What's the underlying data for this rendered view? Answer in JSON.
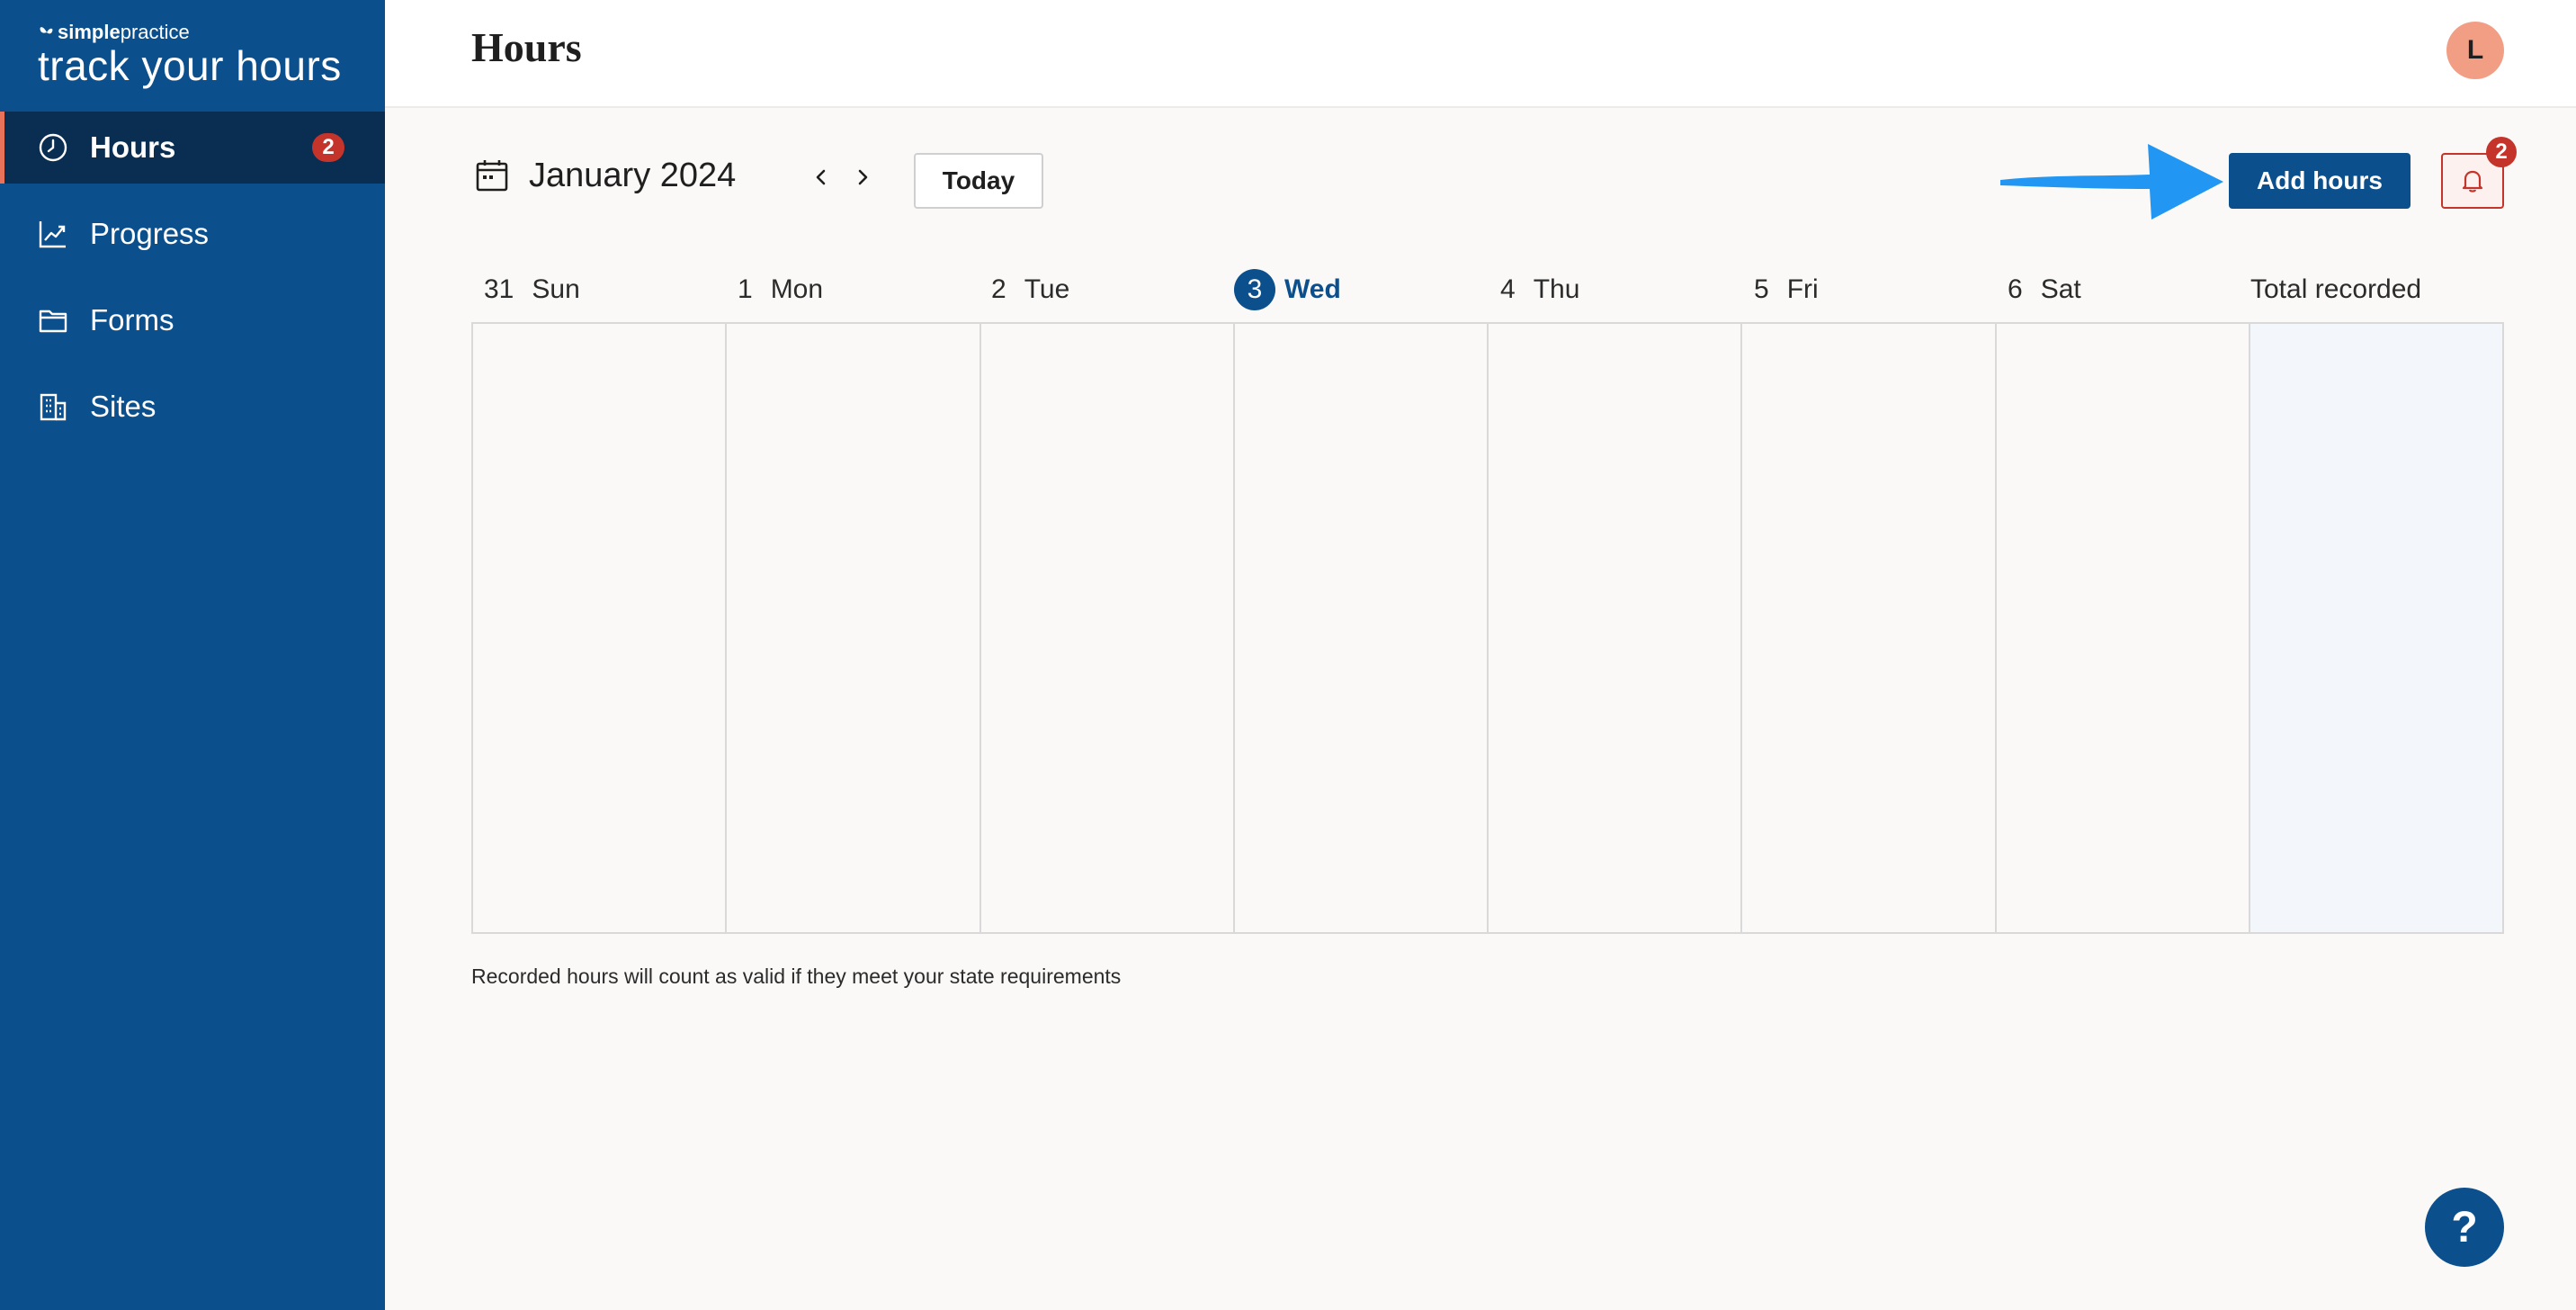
{
  "brand": {
    "small_bold": "simple",
    "small_regular": "practice",
    "title": "track your hours"
  },
  "sidebar": {
    "items": [
      {
        "label": "Hours",
        "icon": "clock-icon",
        "badge": "2",
        "active": true
      },
      {
        "label": "Progress",
        "icon": "chart-line-icon"
      },
      {
        "label": "Forms",
        "icon": "folder-icon"
      },
      {
        "label": "Sites",
        "icon": "building-icon"
      }
    ]
  },
  "header": {
    "title": "Hours",
    "avatar_initial": "L"
  },
  "toolbar": {
    "month": "January 2024",
    "today_label": "Today",
    "add_hours_label": "Add hours",
    "notification_count": "2"
  },
  "week": {
    "days": [
      {
        "num": "31",
        "name": "Sun"
      },
      {
        "num": "1",
        "name": "Mon"
      },
      {
        "num": "2",
        "name": "Tue"
      },
      {
        "num": "3",
        "name": "Wed",
        "today": true
      },
      {
        "num": "4",
        "name": "Thu"
      },
      {
        "num": "5",
        "name": "Fri"
      },
      {
        "num": "6",
        "name": "Sat"
      }
    ],
    "total_label": "Total recorded"
  },
  "footnote": "Recorded hours will count as valid if they meet your state requirements",
  "help_label": "?",
  "colors": {
    "primary": "#0c4f8d",
    "sidebar_active": "#0a2e52",
    "badge": "#c5342a",
    "avatar": "#f19e85",
    "accent_arrow": "#2196f3"
  }
}
